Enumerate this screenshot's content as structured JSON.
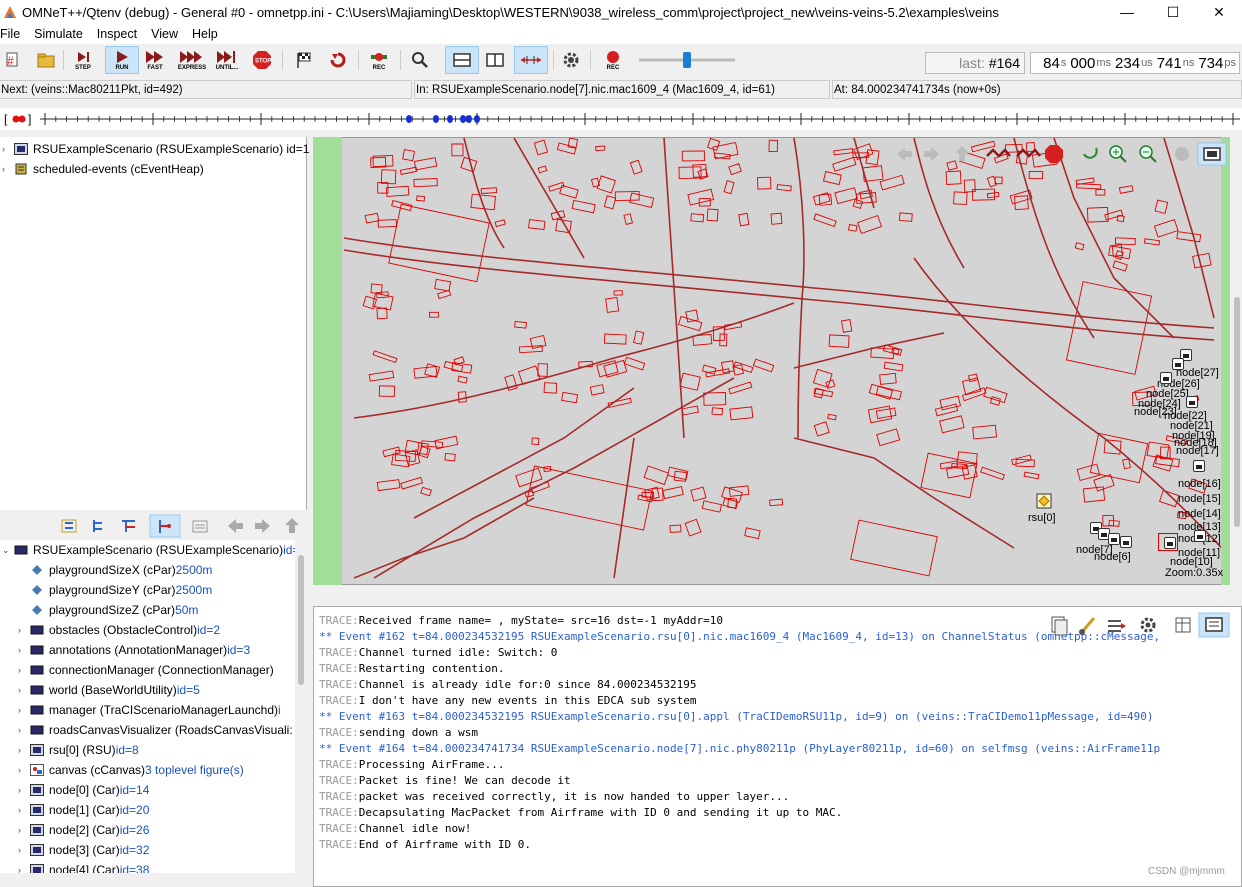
{
  "window": {
    "title": "OMNeT++/Qtenv (debug) - General #0 - omnetpp.ini - C:\\Users\\Majiaming\\Desktop\\WESTERN\\9038_wireless_comm\\project\\project_new\\veins-veins-5.2\\examples\\veins",
    "minimize": "—",
    "maximize": "☐",
    "close": "✕"
  },
  "menu": [
    "File",
    "Simulate",
    "Inspect",
    "View",
    "Help"
  ],
  "toolbar": {
    "step": "STEP",
    "run": "RUN",
    "fast": "FAST",
    "express": "EXPRESS",
    "until": "UNTIL...",
    "stop": "STOP",
    "rec1": "REC",
    "rec2": "REC",
    "last_label": "last:",
    "last_value": "#164",
    "time": [
      {
        "v": "84",
        "u": "s"
      },
      {
        "v": "000",
        "u": "ms"
      },
      {
        "v": "234",
        "u": "us"
      },
      {
        "v": "741",
        "u": "ns"
      },
      {
        "v": "734",
        "u": "ps"
      }
    ]
  },
  "status": {
    "next": "Next:  (veins::Mac80211Pkt, id=492)",
    "in": "In: RSUExampleScenario.node[7].nic.mac1609_4 (Mac1609_4, id=61)",
    "at": "At: 84.000234741734s (now+0s)"
  },
  "timeline": {
    "bracket_open": "[",
    "bracket_close": "]"
  },
  "top_tree": [
    {
      "label": "RSUExampleScenario (RSUExampleScenario) id=1"
    },
    {
      "label": "scheduled-events (cEventHeap)"
    }
  ],
  "bottom_tree": [
    {
      "name": "RSUExampleScenario (RSUExampleScenario)",
      "extra": " id=",
      "level": 0,
      "icon": "module"
    },
    {
      "name": "playgroundSizeX (cPar) ",
      "extra": "2500m",
      "level": 1,
      "icon": "par"
    },
    {
      "name": "playgroundSizeY (cPar) ",
      "extra": "2500m",
      "level": 1,
      "icon": "par"
    },
    {
      "name": "playgroundSizeZ (cPar) ",
      "extra": "50m",
      "level": 1,
      "icon": "par"
    },
    {
      "name": "obstacles (ObstacleControl) ",
      "extra": "id=2",
      "level": 1,
      "icon": "module"
    },
    {
      "name": "annotations (AnnotationManager) ",
      "extra": "id=3",
      "level": 1,
      "icon": "module"
    },
    {
      "name": "connectionManager (ConnectionManager)",
      "extra": "",
      "level": 1,
      "icon": "module"
    },
    {
      "name": "world (BaseWorldUtility) ",
      "extra": "id=5",
      "level": 1,
      "icon": "module"
    },
    {
      "name": "manager (TraCIScenarioManagerLaunchd) ",
      "extra": "i",
      "level": 1,
      "icon": "module"
    },
    {
      "name": "roadsCanvasVisualizer (RoadsCanvasVisuali:",
      "extra": "",
      "level": 1,
      "icon": "module"
    },
    {
      "name": "rsu[0] (RSU) ",
      "extra": "id=8",
      "level": 1,
      "icon": "compound"
    },
    {
      "name": "canvas (cCanvas) ",
      "extra": "3 toplevel figure(s)",
      "level": 1,
      "icon": "canvas"
    },
    {
      "name": "node[0] (Car) ",
      "extra": "id=14",
      "level": 1,
      "icon": "compound"
    },
    {
      "name": "node[1] (Car) ",
      "extra": "id=20",
      "level": 1,
      "icon": "compound"
    },
    {
      "name": "node[2] (Car) ",
      "extra": "id=26",
      "level": 1,
      "icon": "compound"
    },
    {
      "name": "node[3] (Car) ",
      "extra": "id=32",
      "level": 1,
      "icon": "compound"
    },
    {
      "name": "node[4] (Car) ",
      "extra": "id=38",
      "level": 1,
      "icon": "compound"
    }
  ],
  "canvas": {
    "zoom": "Zoom:0.35x",
    "rsu_label": "rsu[0]",
    "node_labels": [
      "node[27]",
      "node[26]",
      "node[25]",
      "node[24]",
      "node[23]",
      "node[22]",
      "node[21]",
      "node[19]",
      "node[18]",
      "node[17]",
      "node[16]",
      "node[15]",
      "node[14]",
      "node[13]",
      "node[12]",
      "node[11]",
      "node[10]",
      "node[6]",
      "node[7]"
    ]
  },
  "log": [
    {
      "t": "trace",
      "prefix": "TRACE:",
      "text": "Received frame name= , myState= src=16 dst=-1 myAddr=10"
    },
    {
      "t": "event",
      "prefix": "",
      "text": "** Event #162  t=84.000234532195  RSUExampleScenario.rsu[0].nic.mac1609_4 (Mac1609_4, id=13)  on ChannelStatus (omnetpp::cMessage,"
    },
    {
      "t": "trace",
      "prefix": "TRACE:",
      "text": "Channel turned idle: Switch: 0"
    },
    {
      "t": "trace",
      "prefix": "TRACE:",
      "text": "Restarting contention."
    },
    {
      "t": "trace",
      "prefix": "TRACE:",
      "text": "Channel is already idle for:0 since 84.000234532195"
    },
    {
      "t": "trace",
      "prefix": "TRACE:",
      "text": "I don't have any new events in this EDCA sub system"
    },
    {
      "t": "event",
      "prefix": "",
      "text": "** Event #163  t=84.000234532195  RSUExampleScenario.rsu[0].appl (TraCIDemoRSU11p, id=9)  on  (veins::TraCIDemo11pMessage, id=490)"
    },
    {
      "t": "trace",
      "prefix": "TRACE:",
      "text": "sending down a wsm"
    },
    {
      "t": "event",
      "prefix": "",
      "text": "** Event #164  t=84.000234741734  RSUExampleScenario.node[7].nic.phy80211p (PhyLayer80211p, id=60)  on selfmsg  (veins::AirFrame11p"
    },
    {
      "t": "trace",
      "prefix": "TRACE:",
      "text": "Processing AirFrame..."
    },
    {
      "t": "trace",
      "prefix": "TRACE:",
      "text": "Packet is fine! We can decode it"
    },
    {
      "t": "trace",
      "prefix": "TRACE:",
      "text": "packet was received correctly, it is now handed to upper layer..."
    },
    {
      "t": "trace",
      "prefix": "TRACE:",
      "text": "Decapsulating MacPacket from Airframe with ID 0 and sending it up to MAC."
    },
    {
      "t": "trace",
      "prefix": "TRACE:",
      "text": "Channel idle now!"
    },
    {
      "t": "trace",
      "prefix": "TRACE:",
      "text": "End of Airframe with ID 0."
    }
  ],
  "watermark": "CSDN @mjmmm",
  "colors": {
    "road": "#b22222",
    "building": "#e00000",
    "grass": "#a2dd9a",
    "canvas": "#d4d4d4",
    "event_log": "#2b5fd0",
    "accent": "#1a7fd4"
  }
}
